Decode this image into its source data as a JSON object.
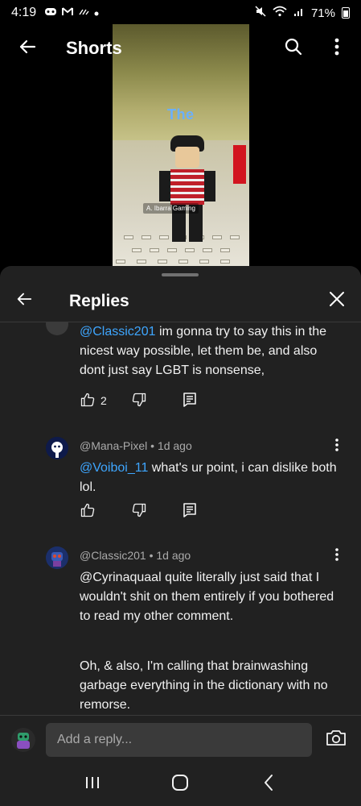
{
  "status_bar": {
    "time": "4:19",
    "battery": "71%",
    "icons": [
      "gamepad-icon",
      "gmail-icon",
      "signal-dots-icon",
      "mute-icon",
      "wifi-icon",
      "cell-signal-icon",
      "battery-icon"
    ]
  },
  "header": {
    "title": "Shorts",
    "icons": [
      "back-arrow-icon",
      "search-icon",
      "more-vert-icon"
    ]
  },
  "video": {
    "overlay_title": "The",
    "watermark": "A. Ibarra Gaming"
  },
  "replies_panel": {
    "title": "Replies",
    "comments": [
      {
        "mention": "@Classic201",
        "text": " im gonna try to say this in the nicest way possible, let them be, and also dont just say LGBT is nonsense,",
        "likes": "2"
      },
      {
        "author": "@Mana-Pixel",
        "time": "1d ago",
        "mention": "@Voiboi_11",
        "text": " what's ur point, i can dislike both lol.",
        "likes": ""
      },
      {
        "author": "@Classic201",
        "time": "1d ago",
        "text": "@Cyrinaquaal quite literally just said that I wouldn't shit on them entirely if you bothered to read my other comment.",
        "text2": "Oh, & also, I'm calling that brainwashing garbage everything in the dictionary with no remorse."
      }
    ]
  },
  "reply_input": {
    "placeholder": "Add a reply..."
  },
  "colors": {
    "panel_bg": "#212121",
    "mention": "#3ea6ff",
    "meta_text": "#aaaaaa",
    "input_bg": "#3a3a3a"
  }
}
